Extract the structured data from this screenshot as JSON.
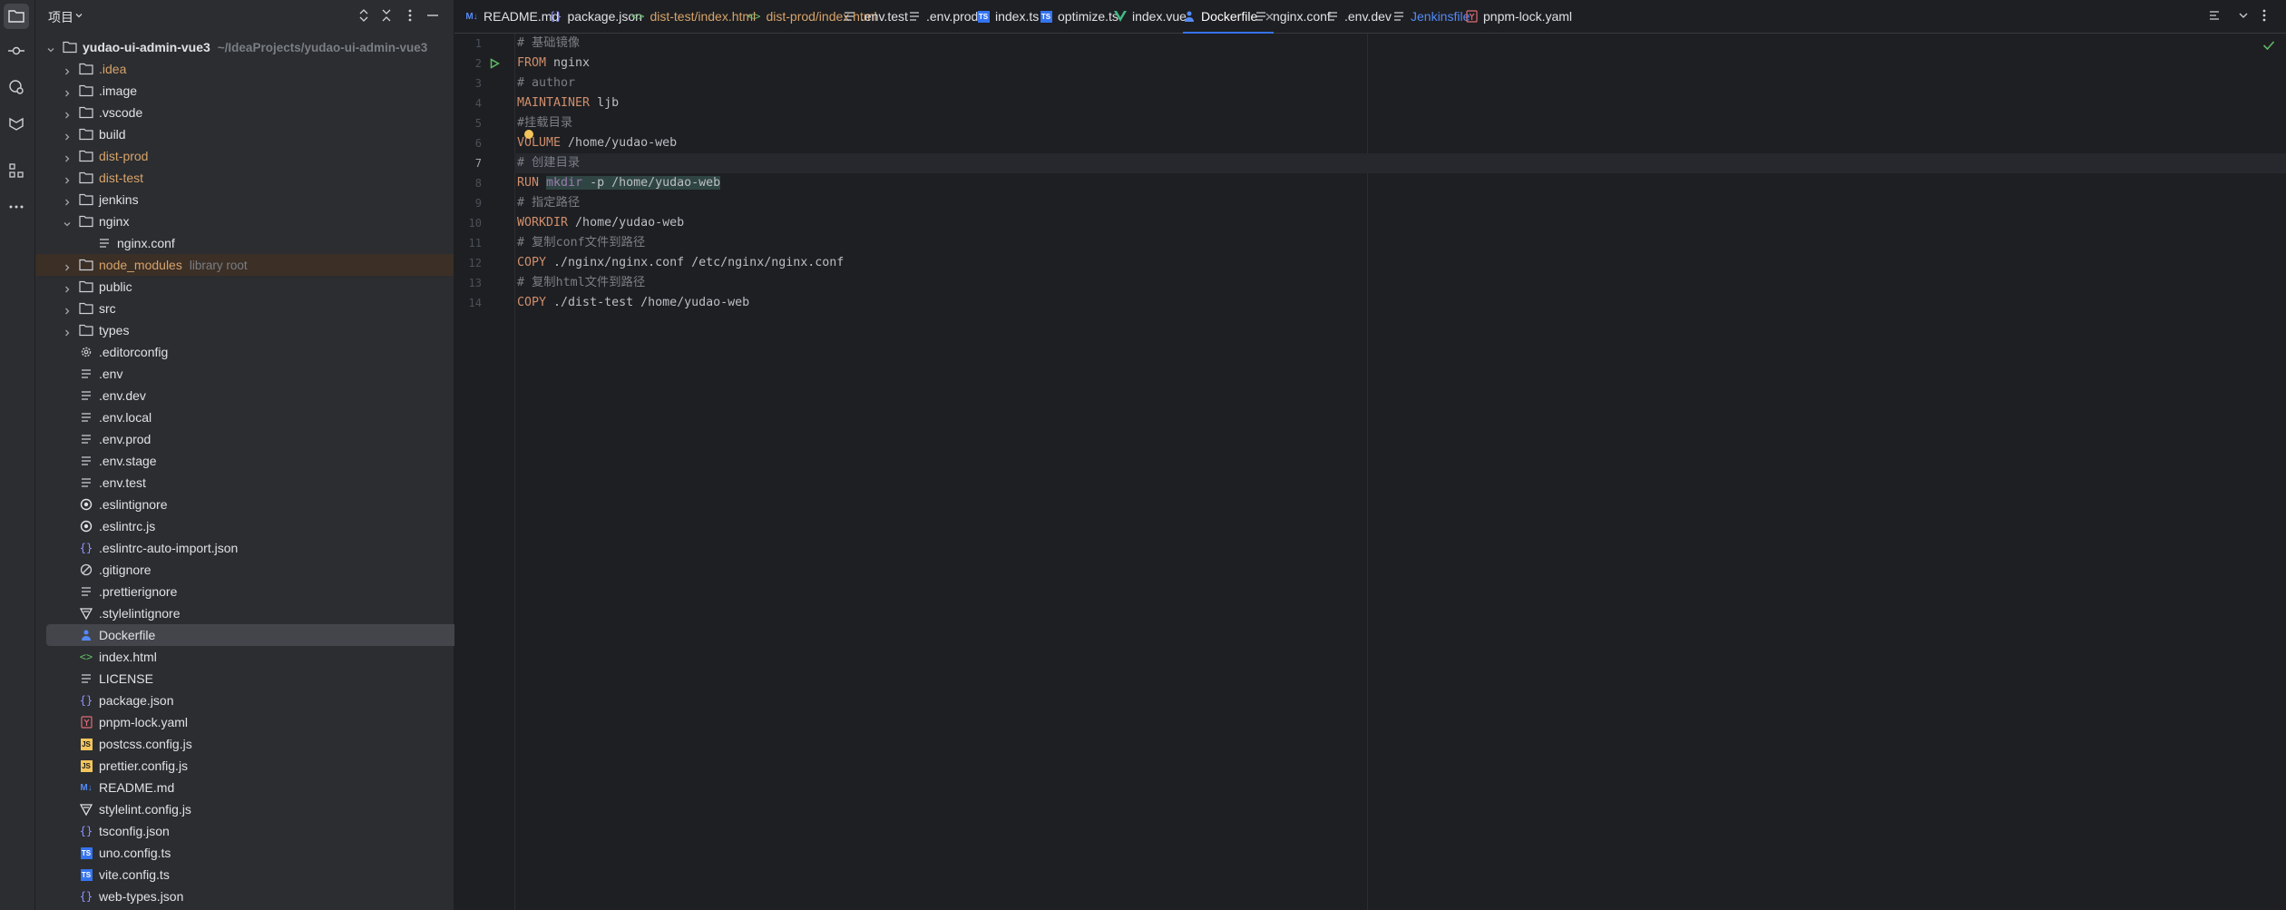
{
  "activity_bar": {
    "items": [
      {
        "name": "project",
        "active": true
      },
      {
        "name": "commit",
        "active": false
      },
      {
        "name": "services",
        "active": false
      },
      {
        "name": "learn",
        "active": false
      },
      {
        "name": "structure",
        "active": false
      },
      {
        "name": "more",
        "active": false
      }
    ]
  },
  "project_panel": {
    "title": "项目",
    "root": {
      "label": "yudao-ui-admin-vue3",
      "path": "~/IdeaProjects/yudao-ui-admin-vue3"
    },
    "items": [
      {
        "label": ".idea",
        "type": "folder",
        "color": "orange"
      },
      {
        "label": ".image",
        "type": "folder"
      },
      {
        "label": ".vscode",
        "type": "folder"
      },
      {
        "label": "build",
        "type": "folder"
      },
      {
        "label": "dist-prod",
        "type": "folder",
        "color": "orange"
      },
      {
        "label": "dist-test",
        "type": "folder",
        "color": "orange"
      },
      {
        "label": "jenkins",
        "type": "folder"
      },
      {
        "label": "nginx",
        "type": "folder-open"
      },
      {
        "label": "nginx.conf",
        "type": "file-text",
        "child": true
      },
      {
        "label": "node_modules",
        "type": "folder",
        "color": "orange",
        "hint": "library root"
      },
      {
        "label": "public",
        "type": "folder"
      },
      {
        "label": "src",
        "type": "folder"
      },
      {
        "label": "types",
        "type": "folder"
      },
      {
        "label": ".editorconfig",
        "type": "gear"
      },
      {
        "label": ".env",
        "type": "file-text"
      },
      {
        "label": ".env.dev",
        "type": "file-text"
      },
      {
        "label": ".env.local",
        "type": "file-text"
      },
      {
        "label": ".env.prod",
        "type": "file-text"
      },
      {
        "label": ".env.stage",
        "type": "file-text"
      },
      {
        "label": ".env.test",
        "type": "file-text"
      },
      {
        "label": ".eslintignore",
        "type": "eslint"
      },
      {
        "label": ".eslintrc.js",
        "type": "eslint"
      },
      {
        "label": ".eslintrc-auto-import.json",
        "type": "json"
      },
      {
        "label": ".gitignore",
        "type": "ignore"
      },
      {
        "label": ".prettierignore",
        "type": "file-text"
      },
      {
        "label": ".stylelintignore",
        "type": "stylelint"
      },
      {
        "label": "Dockerfile",
        "type": "docker",
        "selected": true
      },
      {
        "label": "index.html",
        "type": "html"
      },
      {
        "label": "LICENSE",
        "type": "file-text"
      },
      {
        "label": "package.json",
        "type": "json"
      },
      {
        "label": "pnpm-lock.yaml",
        "type": "yaml"
      },
      {
        "label": "postcss.config.js",
        "type": "js"
      },
      {
        "label": "prettier.config.js",
        "type": "js"
      },
      {
        "label": "README.md",
        "type": "md"
      },
      {
        "label": "stylelint.config.js",
        "type": "stylelint"
      },
      {
        "label": "tsconfig.json",
        "type": "json"
      },
      {
        "label": "uno.config.ts",
        "type": "ts"
      },
      {
        "label": "vite.config.ts",
        "type": "ts"
      },
      {
        "label": "web-types.json",
        "type": "json"
      }
    ]
  },
  "tabs": [
    {
      "label": "README.md",
      "icon": "md"
    },
    {
      "label": "package.json",
      "icon": "json"
    },
    {
      "label": "dist-test/index.html",
      "icon": "html",
      "color": "orange"
    },
    {
      "label": "dist-prod/index.html",
      "icon": "html",
      "color": "orange"
    },
    {
      "label": ".env.test",
      "icon": "text"
    },
    {
      "label": ".env.prod",
      "icon": "text"
    },
    {
      "label": "index.ts",
      "icon": "ts"
    },
    {
      "label": "optimize.ts",
      "icon": "ts"
    },
    {
      "label": "index.vue",
      "icon": "vue"
    },
    {
      "label": "Dockerfile",
      "icon": "docker",
      "active": true
    },
    {
      "label": "nginx.conf",
      "icon": "text"
    },
    {
      "label": ".env.dev",
      "icon": "text"
    },
    {
      "label": "Jenkinsfile",
      "icon": "text",
      "color": "blue"
    },
    {
      "label": "pnpm-lock.yaml",
      "icon": "yaml"
    }
  ],
  "editor": {
    "current_line": 7,
    "lines": [
      {
        "n": "1",
        "text": "# 基础镜像"
      },
      {
        "n": "2",
        "text": "FROM nginx"
      },
      {
        "n": "3",
        "text": "# author"
      },
      {
        "n": "4",
        "text": "MAINTAINER ljb"
      },
      {
        "n": "5",
        "text": "#挂载目录"
      },
      {
        "n": "6",
        "text": "VOLUME /home/yudao-web"
      },
      {
        "n": "7",
        "text": "# 创建目录"
      },
      {
        "n": "8",
        "text": "RUN mkdir -p /home/yudao-web"
      },
      {
        "n": "9",
        "text": "# 指定路径"
      },
      {
        "n": "10",
        "text": "WORKDIR /home/yudao-web"
      },
      {
        "n": "11",
        "text": "# 复制conf文件到路径"
      },
      {
        "n": "12",
        "text": "COPY ./nginx/nginx.conf /etc/nginx/nginx.conf"
      },
      {
        "n": "13",
        "text": "# 复制html文件到路径"
      },
      {
        "n": "14",
        "text": "COPY ./dist-test /home/yudao-web"
      }
    ]
  },
  "colors": {
    "accent": "#3574f0",
    "keyword": "#cf8e6d",
    "comment": "#7a7e85",
    "folder_orange": "#d7a36b"
  }
}
